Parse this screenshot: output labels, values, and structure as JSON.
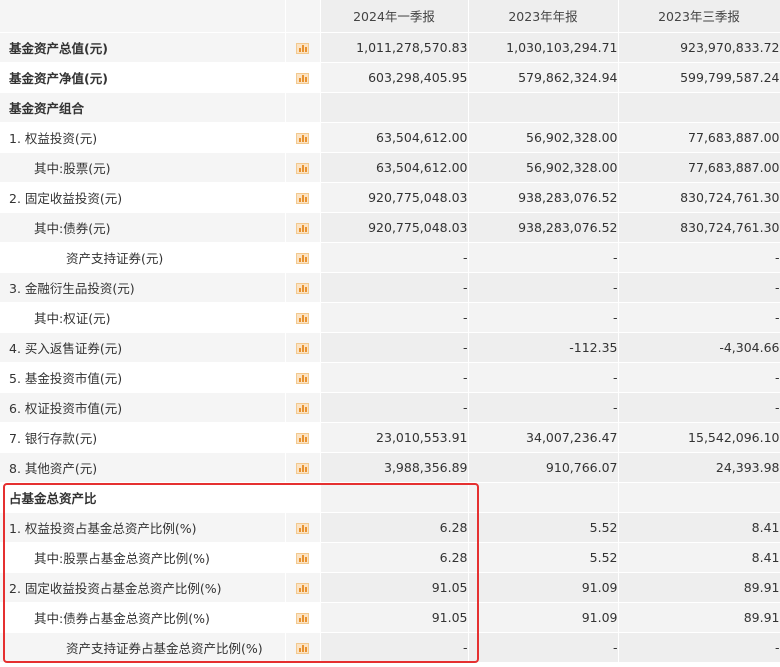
{
  "header": {
    "col1": "2024年一季报",
    "col2": "2023年年报",
    "col3": "2023年三季报"
  },
  "rows": [
    {
      "label": "基金资产总值(元)",
      "v1": "1,011,278,570.83",
      "v2": "1,030,103,294.71",
      "v3": "923,970,833.72"
    },
    {
      "label": "基金资产净值(元)",
      "v1": "603,298,405.95",
      "v2": "579,862,324.94",
      "v3": "599,799,587.24"
    },
    {
      "label": "基金资产组合",
      "v1": "",
      "v2": "",
      "v3": ""
    },
    {
      "label": "1. 权益投资(元)",
      "v1": "63,504,612.00",
      "v2": "56,902,328.00",
      "v3": "77,683,887.00"
    },
    {
      "label": "其中:股票(元)",
      "v1": "63,504,612.00",
      "v2": "56,902,328.00",
      "v3": "77,683,887.00"
    },
    {
      "label": "2. 固定收益投资(元)",
      "v1": "920,775,048.03",
      "v2": "938,283,076.52",
      "v3": "830,724,761.30"
    },
    {
      "label": "其中:债券(元)",
      "v1": "920,775,048.03",
      "v2": "938,283,076.52",
      "v3": "830,724,761.30"
    },
    {
      "label": "资产支持证券(元)",
      "v1": "-",
      "v2": "-",
      "v3": "-"
    },
    {
      "label": "3. 金融衍生品投资(元)",
      "v1": "-",
      "v2": "-",
      "v3": "-"
    },
    {
      "label": "其中:权证(元)",
      "v1": "-",
      "v2": "-",
      "v3": "-"
    },
    {
      "label": "4. 买入返售证券(元)",
      "v1": "-",
      "v2": "-112.35",
      "v3": "-4,304.66"
    },
    {
      "label": "5. 基金投资市值(元)",
      "v1": "-",
      "v2": "-",
      "v3": "-"
    },
    {
      "label": "6. 权证投资市值(元)",
      "v1": "-",
      "v2": "-",
      "v3": "-"
    },
    {
      "label": "7. 银行存款(元)",
      "v1": "23,010,553.91",
      "v2": "34,007,236.47",
      "v3": "15,542,096.10"
    },
    {
      "label": "8. 其他资产(元)",
      "v1": "3,988,356.89",
      "v2": "910,766.07",
      "v3": "24,393.98"
    },
    {
      "label": "占基金总资产比",
      "v1": "",
      "v2": "",
      "v3": ""
    },
    {
      "label": "1. 权益投资占基金总资产比例(%)",
      "v1": "6.28",
      "v2": "5.52",
      "v3": "8.41"
    },
    {
      "label": "其中:股票占基金总资产比例(%)",
      "v1": "6.28",
      "v2": "5.52",
      "v3": "8.41"
    },
    {
      "label": "2. 固定收益投资占基金总资产比例(%)",
      "v1": "91.05",
      "v2": "91.09",
      "v3": "89.91"
    },
    {
      "label": "其中:债券占基金总资产比例(%)",
      "v1": "91.05",
      "v2": "91.09",
      "v3": "89.91"
    },
    {
      "label": "资产支持证券占基金总资产比例(%)",
      "v1": "-",
      "v2": "-",
      "v3": "-"
    }
  ],
  "icons": {
    "chart": "bar-chart-icon"
  },
  "colors": {
    "highlight": "#e53030",
    "icon": "#e8922f"
  }
}
